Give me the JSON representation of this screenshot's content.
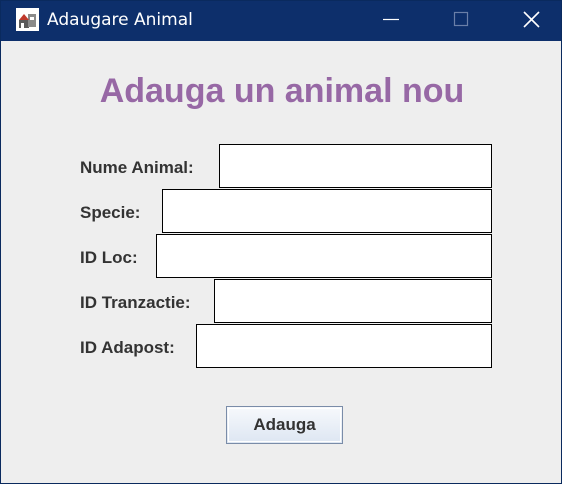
{
  "window": {
    "title": "Adaugare Animal",
    "icon": "app-icon"
  },
  "controls": {
    "minimize_icon": "minimize-icon",
    "maximize_icon": "maximize-icon",
    "close_icon": "close-icon"
  },
  "form": {
    "heading": "Adauga un animal nou",
    "fields": [
      {
        "label": "Nume Animal:",
        "value": ""
      },
      {
        "label": "Specie:",
        "value": ""
      },
      {
        "label": "ID Loc:",
        "value": ""
      },
      {
        "label": "ID Tranzactie:",
        "value": ""
      },
      {
        "label": "ID Adapost:",
        "value": ""
      }
    ],
    "submit_label": "Adauga"
  },
  "colors": {
    "titlebar": "#0d2f6b",
    "heading": "#9768a5",
    "background": "#eeeeee"
  }
}
